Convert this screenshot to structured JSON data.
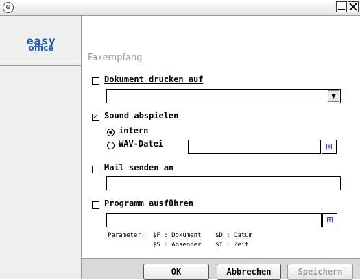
{
  "window": {
    "minimize_icon": "minimize-icon",
    "close_icon": "close-icon"
  },
  "sidebar": {
    "logo_line1": "easy",
    "logo_line2": "office"
  },
  "section": {
    "title": "Faxempfang"
  },
  "print": {
    "label": "Dokument drucken auf",
    "checked": false,
    "selected_value": ""
  },
  "sound": {
    "label": "Sound abspielen",
    "checked": true,
    "option_intern": "intern",
    "option_wav": "WAV-Datei",
    "selected": "intern",
    "wav_value": ""
  },
  "mail": {
    "label": "Mail senden an",
    "checked": false,
    "value": ""
  },
  "program": {
    "label": "Programm ausführen",
    "checked": false,
    "value": "",
    "params_label": "Parameter:",
    "param_f": "$F : Dokument",
    "param_d": "$D : Datum",
    "param_s": "$S : Absender",
    "param_t": "$T : Zeit"
  },
  "footer": {
    "ok": "OK",
    "cancel": "Abbrechen",
    "save": "Speichern"
  }
}
